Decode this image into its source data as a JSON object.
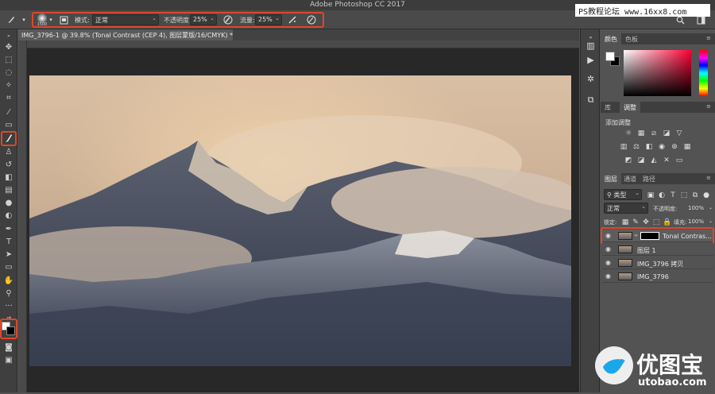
{
  "window": {
    "title": "Adobe Photoshop CC 2017"
  },
  "watermark": {
    "text": "PS教程论坛 www.16xx8.com"
  },
  "options": {
    "brush_size": "1500",
    "mode_label": "模式:",
    "mode_value": "正常",
    "opacity_label": "不透明度:",
    "opacity_value": "25%",
    "flow_label": "流量:",
    "flow_value": "25%"
  },
  "document": {
    "tab_title": "IMG_3796-1 @ 39.8% (Tonal Contrast (CEP 4), 图层蒙版/16/CMYK) *"
  },
  "colors": {
    "highlight": "#e0452a",
    "foreground": "#ffffff",
    "background": "#000000"
  },
  "panels": {
    "color_tab": "颜色",
    "swatches_tab": "色板",
    "libraries_tab": "库",
    "adjustments_tab": "调整",
    "add_adjustment": "添加调整",
    "layers_tab": "图层",
    "channels_tab": "通道",
    "paths_tab": "路径",
    "filter_kind": "类型",
    "blend_mode": "正常",
    "opacity_label": "不透明度:",
    "opacity_value": "100%",
    "lock_label": "锁定:",
    "fill_label": "填充:",
    "fill_value": "100%",
    "layers": [
      {
        "name": "Tonal Contras..."
      },
      {
        "name": "图层 1"
      },
      {
        "name": "IMG_3796 拷贝"
      },
      {
        "name": "IMG_3796"
      }
    ]
  },
  "brand": {
    "name": "优图宝",
    "url": "utobao.com"
  }
}
